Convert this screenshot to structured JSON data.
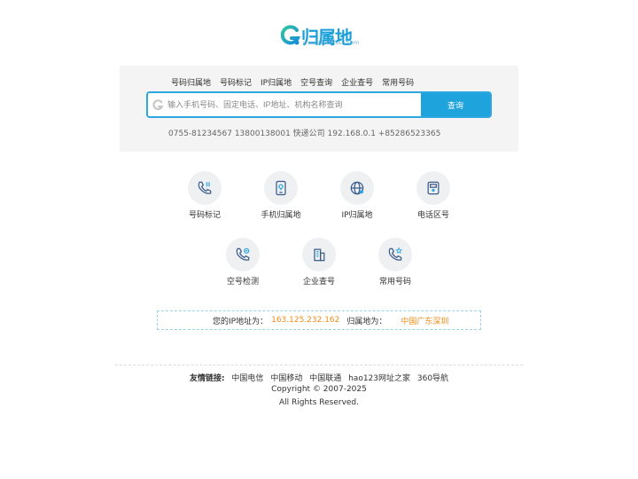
{
  "logo": {
    "text": "归属地",
    "subtext": "www.GuiShuDi.com"
  },
  "tabs": [
    "号码归属地",
    "号码标记",
    "IP归属地",
    "空号查询",
    "企业查号",
    "常用号码"
  ],
  "search": {
    "placeholder": "输入手机号码、固定电话、IP地址、机构名称查询",
    "button": "查询",
    "examples": "0755-81234567 13800138001 快递公司 192.168.0.1 +85286523365"
  },
  "features": [
    {
      "label": "号码标记",
      "icon": "phone-mark-icon"
    },
    {
      "label": "手机归属地",
      "icon": "mobile-location-icon"
    },
    {
      "label": "IP归属地",
      "icon": "globe-icon"
    },
    {
      "label": "电话区号",
      "icon": "area-code-icon"
    },
    {
      "label": "空号检测",
      "icon": "phone-check-icon"
    },
    {
      "label": "企业查号",
      "icon": "building-icon"
    },
    {
      "label": "常用号码",
      "icon": "phone-star-icon"
    }
  ],
  "ip": {
    "label": "您的IP地址为：",
    "value": "163.125.232.162",
    "location_label": "归属地为：",
    "location_value": "中国广东深圳"
  },
  "footer": {
    "links_title": "友情链接:",
    "links": [
      "中国电信",
      "中国移动",
      "中国联通",
      "hao123网址之家",
      "360导航"
    ],
    "copyright": "Copyright © 2007-2025",
    "rights": "All Rights Reserved."
  },
  "colors": {
    "accent": "#1fa3dc",
    "highlight": "#f08c1a",
    "panel_bg": "#f4f4f4"
  }
}
